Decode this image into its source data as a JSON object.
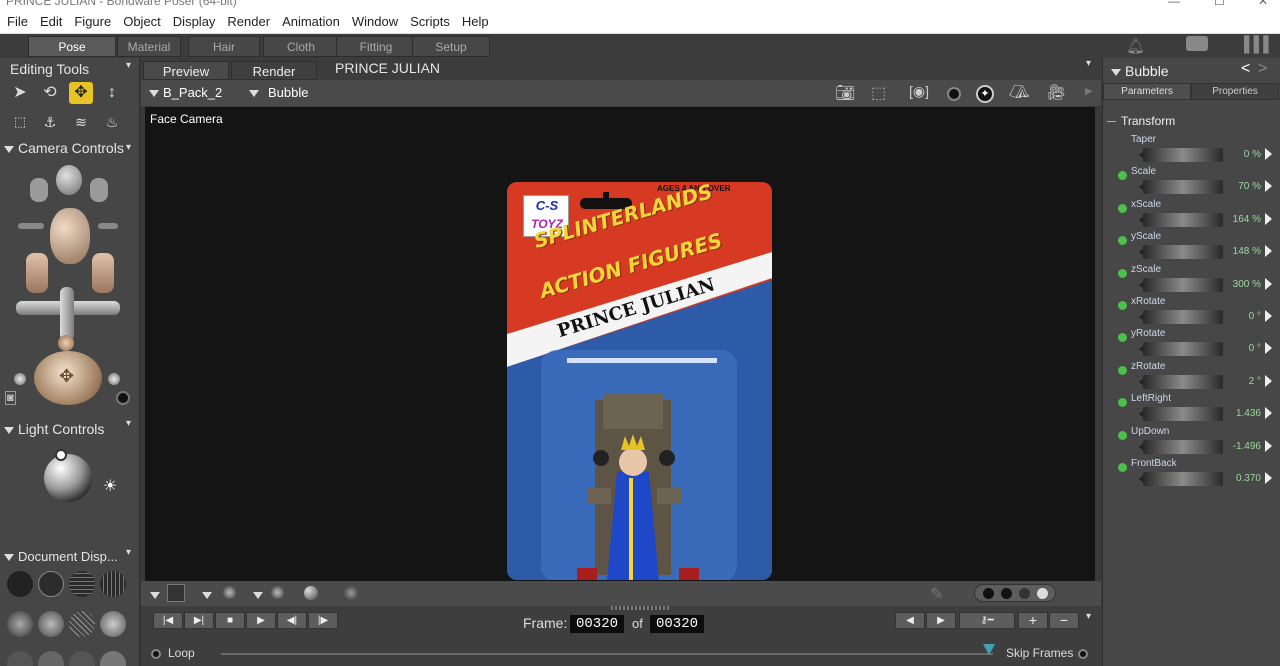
{
  "window": {
    "title": "PRINCE JULIAN - Bondware Poser (64-bit)"
  },
  "menu": [
    "File",
    "Edit",
    "Figure",
    "Object",
    "Display",
    "Render",
    "Animation",
    "Window",
    "Scripts",
    "Help"
  ],
  "rooms": [
    "Pose",
    "Material",
    "Hair",
    "Cloth",
    "Fitting",
    "Setup"
  ],
  "left": {
    "editing_tools": "Editing Tools",
    "camera_controls": "Camera Controls",
    "light_controls": "Light Controls",
    "document_display": "Document  Disp..."
  },
  "viewport": {
    "tabs": [
      "Preview",
      "Render"
    ],
    "doc_title": "PRINCE JULIAN",
    "figure_select": "B_Pack_2",
    "actor_select": "Bubble",
    "camera_label": "Face Camera"
  },
  "card": {
    "logo_line1": "C-S",
    "logo_line2": "TOYZ",
    "ages": "AGES 4 AND OVER",
    "title1": "SPLINTERLANDS",
    "title2": "ACTION FIGURES",
    "name": "PRINCE JULIAN"
  },
  "timeline": {
    "frame_label": "Frame:",
    "frame_current": "00320",
    "of_label": "of",
    "frame_total": "00320",
    "loop_label": "Loop",
    "skip_label": "Skip Frames"
  },
  "right": {
    "actor_name": "Bubble",
    "tabs": [
      "Parameters",
      "Properties"
    ],
    "group": "Transform",
    "params": [
      {
        "name": "Taper",
        "value": "0 %",
        "dot": false
      },
      {
        "name": "Scale",
        "value": "70 %",
        "dot": true
      },
      {
        "name": "xScale",
        "value": "164 %",
        "dot": true
      },
      {
        "name": "yScale",
        "value": "148 %",
        "dot": true
      },
      {
        "name": "zScale",
        "value": "300 %",
        "dot": true
      },
      {
        "name": "xRotate",
        "value": "0 °",
        "dot": true
      },
      {
        "name": "yRotate",
        "value": "0 °",
        "dot": true
      },
      {
        "name": "zRotate",
        "value": "2 °",
        "dot": true
      },
      {
        "name": "LeftRight",
        "value": "1.436",
        "dot": true
      },
      {
        "name": "UpDown",
        "value": "-1.496",
        "dot": true
      },
      {
        "name": "FrontBack",
        "value": "0.370",
        "dot": true
      }
    ]
  }
}
